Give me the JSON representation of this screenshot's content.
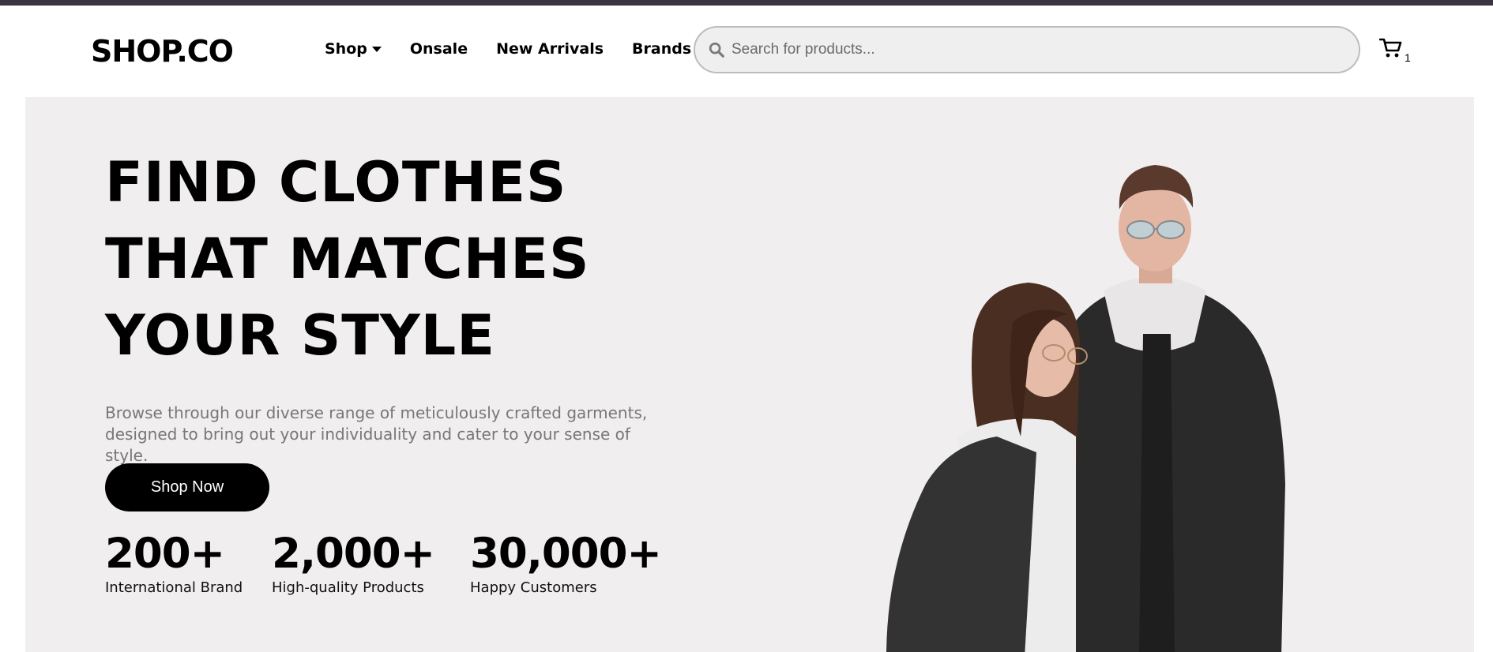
{
  "header": {
    "logo": "SHOP.CO",
    "nav": [
      {
        "label": "Shop",
        "has_dropdown": true
      },
      {
        "label": "Onsale"
      },
      {
        "label": "New Arrivals"
      },
      {
        "label": "Brands"
      }
    ],
    "search": {
      "placeholder": "Search for products...",
      "value": "",
      "icon": "search-icon"
    },
    "cart": {
      "icon": "cart-icon",
      "count": "1"
    }
  },
  "hero": {
    "headline": [
      "FIND CLOTHES",
      "THAT MATCHES",
      "YOUR STYLE"
    ],
    "subtext": [
      "Browse through our diverse range of meticulously crafted garments,",
      "designed to bring out your individuality and cater to your sense of style."
    ],
    "cta_label": "Shop Now",
    "stats": [
      {
        "value": "200+",
        "label": "International Brand"
      },
      {
        "value": "2,000+",
        "label": "High-quality Products"
      },
      {
        "value": "30,000+",
        "label": "Happy Customers"
      }
    ]
  },
  "colors": {
    "top_accent": "#3a3342",
    "hero_bg": "#f0eeef",
    "button_bg": "#000000",
    "button_text": "#ffffff",
    "muted_text": "#777777"
  }
}
